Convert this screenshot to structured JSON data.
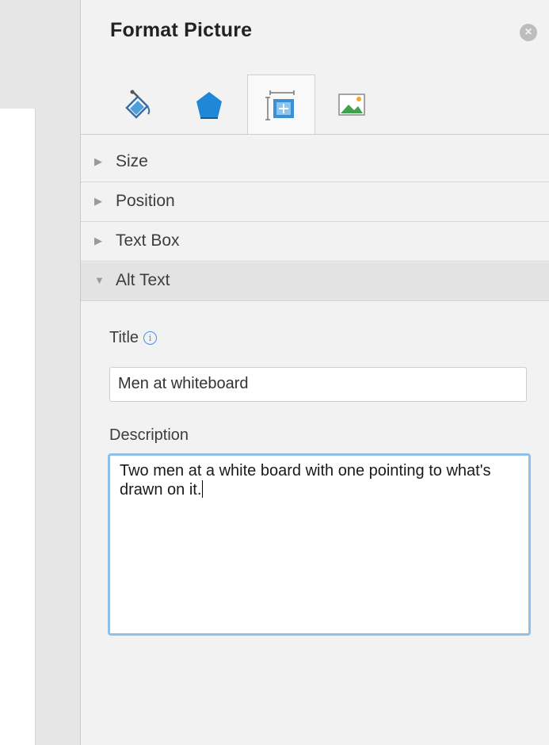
{
  "pane": {
    "title": "Format Picture",
    "close_icon": "close-icon"
  },
  "tabs": [
    {
      "name": "fill-line",
      "icon": "paint-bucket-icon",
      "selected": false
    },
    {
      "name": "effects",
      "icon": "pentagon-icon",
      "selected": false
    },
    {
      "name": "size-properties",
      "icon": "size-properties-icon",
      "selected": true
    },
    {
      "name": "picture",
      "icon": "picture-icon",
      "selected": false
    }
  ],
  "sections": [
    {
      "label": "Size",
      "expanded": false
    },
    {
      "label": "Position",
      "expanded": false
    },
    {
      "label": "Text Box",
      "expanded": false
    },
    {
      "label": "Alt Text",
      "expanded": true
    }
  ],
  "alt_text": {
    "title_label": "Title",
    "title_value": "Men at whiteboard",
    "description_label": "Description",
    "description_value": "Two men at a white board with one pointing to what's drawn on it."
  },
  "colors": {
    "accent": "#4a90e2",
    "focus_ring": "#8fc0ea",
    "pane_bg": "#f2f2f2"
  }
}
